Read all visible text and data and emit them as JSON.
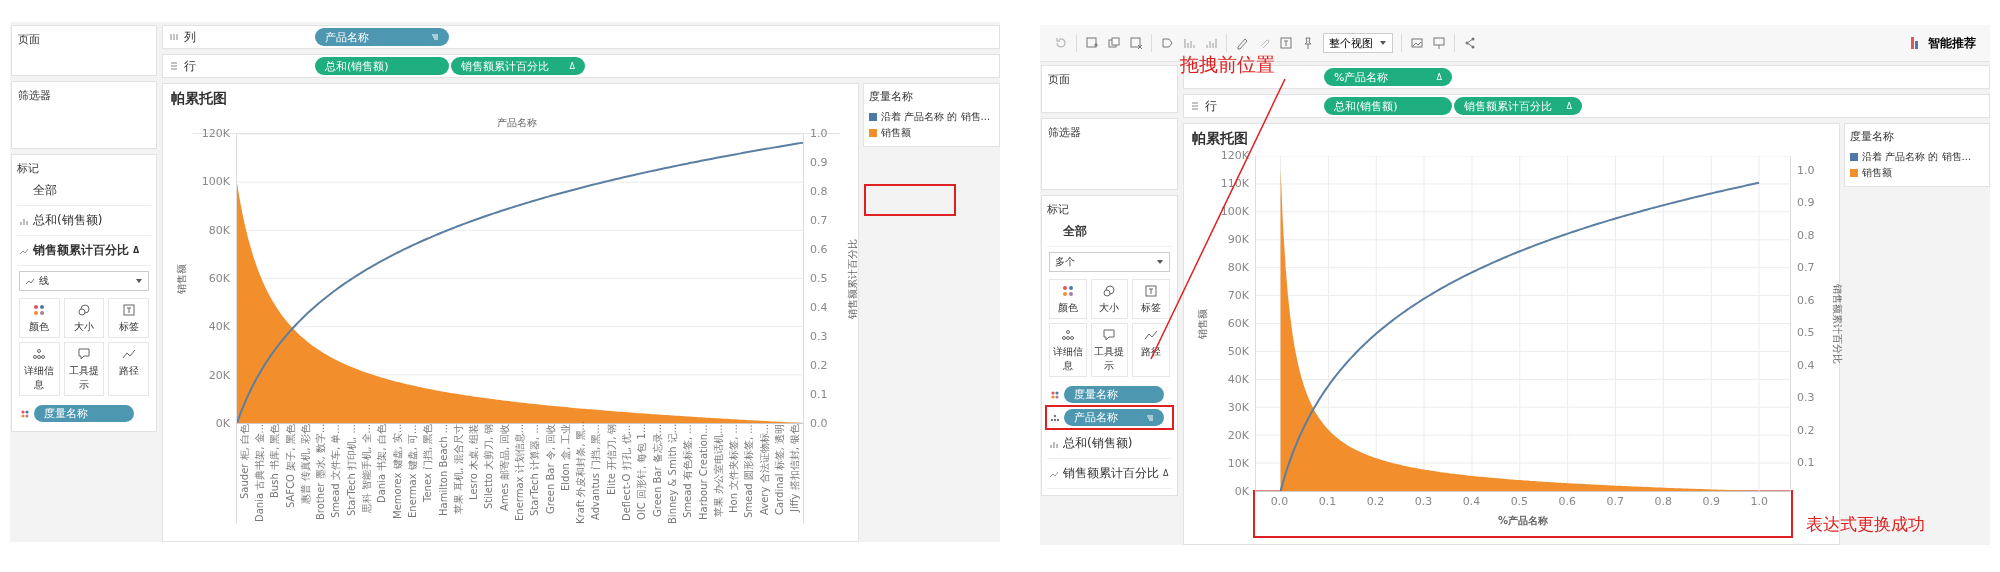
{
  "screens": [
    {
      "panes": {
        "pages": "页面",
        "filters": "筛选器"
      },
      "shelves": [
        {
          "kind": "columns",
          "label": "列",
          "pills": [
            {
              "label": "产品名称",
              "kind": "dimension",
              "sorted": true
            }
          ]
        },
        {
          "kind": "rows",
          "label": "行",
          "pills": [
            {
              "label": "总和(销售额)",
              "kind": "measure",
              "sorted": false
            },
            {
              "label": "销售额累计百分比",
              "kind": "measure",
              "sorted": false,
              "badge": "Δ"
            }
          ]
        }
      ],
      "marks": {
        "title": "标记",
        "tabs": [
          {
            "label": "全部",
            "kind": "all",
            "selected": false
          },
          {
            "label": "总和(销售额)",
            "kind": "bar",
            "selected": false
          },
          {
            "label": "销售额累计百分比",
            "kind": "line",
            "selected": true,
            "badge": "Δ"
          }
        ],
        "mark_type": {
          "kind": "line",
          "value": "线"
        },
        "buttons": [
          {
            "label": "颜色",
            "kind": "color"
          },
          {
            "label": "大小",
            "kind": "size"
          },
          {
            "label": "标签",
            "kind": "label"
          },
          {
            "label": "详细信息",
            "kind": "detail"
          },
          {
            "label": "工具提示",
            "kind": "tooltip"
          },
          {
            "label": "路径",
            "kind": "path"
          }
        ],
        "pills": [
          {
            "label": "度量名称",
            "kind": "color",
            "sorted": false,
            "annotated": false
          }
        ]
      },
      "chart": {
        "title": "帕累托图",
        "x_header": "产品名称",
        "y_label": "销售额",
        "y2_label": "销售额累计百分比",
        "y_ticks": [
          "120K",
          "100K",
          "80K",
          "60K",
          "40K",
          "20K",
          "0K"
        ],
        "y2_ticks": [
          "1.0",
          "0.9",
          "0.8",
          "0.7",
          "0.6",
          "0.5",
          "0.4",
          "0.3",
          "0.2",
          "0.1",
          "0.0"
        ],
        "x_labels": [
          "Sauder 柜, 白色",
          "Dania 古典书架, 金...",
          "Bush 书库, 黑色",
          "SAFCO 架子, 黑色",
          "惠普 传真机, 彩色",
          "Brother 墨水, 数字...",
          "Smead 文件车, 单...",
          "StarTech 打印机, ...",
          "思科 智能手机, 全...",
          "Dania 书架, 白色",
          "Memorex 键盘, 实...",
          "Enermax 键盘, 可...",
          "Tenex 门挡, 黑色",
          "Hamilton Beach ...",
          "苹果 耳机, 混合尺寸",
          "Lesro 木桌, 组装",
          "Stiletto 大剪刀, 钢",
          "Ames 邮寄品, 回收",
          "Enermax 计划信息...",
          "StarTech 计算器, ...",
          "Green Bar 令, 回收",
          "Eldon 盒, 工业",
          "Kraft 外皮和封条, 黑...",
          "Advantus 门挡, 黑...",
          "Elite 开信刀, 钢",
          "Deflect-O 打孔, 优...",
          "OIC 回形针, 每包 1...",
          "Green Bar 备忘录...",
          "Binney & Smith 记...",
          "Smead 有色标签, ...",
          "Harbour Creation...",
          "苹果 办公室电话机...",
          "Hon 文件夹标签, ...",
          "Smead 圆形标签, ...",
          "Avery 合法证物标...",
          "Cardinal 标签, 透明",
          "Jiffy 搭扣信封, 银色"
        ]
      },
      "legend": {
        "title": "度量名称",
        "annotation_box": true,
        "items": [
          {
            "label": "沿着 产品名称 的 销售...",
            "color": "#4e79a7"
          },
          {
            "label": "销售额",
            "color": "#f28e2b"
          }
        ]
      }
    },
    {
      "toolbar": {
        "view": "整个视图",
        "recommend": "智能推荐"
      },
      "panes": {
        "pages": "页面",
        "filters": "筛选器"
      },
      "shelf_note": "拖拽前位置",
      "shelves": [
        {
          "pills": [
            {
              "label": "%产品名称",
              "kind": "measure",
              "sorted": false,
              "badge": "Δ"
            }
          ]
        },
        {
          "kind": "rows",
          "label": "行",
          "pills": [
            {
              "label": "总和(销售额)",
              "kind": "measure",
              "sorted": false
            },
            {
              "label": "销售额累计百分比",
              "kind": "measure",
              "sorted": false,
              "badge": "Δ"
            }
          ]
        }
      ],
      "marks": {
        "title": "标记",
        "tabs": [
          {
            "label": "全部",
            "kind": "all",
            "selected": true
          },
          {
            "label": "总和(销售额)",
            "kind": "bar",
            "selected": false
          },
          {
            "label": "销售额累计百分比",
            "kind": "line",
            "selected": false,
            "badge": "Δ"
          }
        ],
        "mark_type": {
          "kind": "multiple",
          "value": "多个"
        },
        "buttons": [
          {
            "label": "颜色",
            "kind": "color"
          },
          {
            "label": "大小",
            "kind": "size"
          },
          {
            "label": "标签",
            "kind": "label"
          },
          {
            "label": "详细信息",
            "kind": "detail"
          },
          {
            "label": "工具提示",
            "kind": "tooltip"
          },
          {
            "label": "路径",
            "kind": "path"
          }
        ],
        "pills": [
          {
            "label": "度量名称",
            "kind": "color",
            "sorted": false,
            "annotated": false
          },
          {
            "label": "产品名称",
            "kind": "detail",
            "sorted": true,
            "annotated": true
          }
        ]
      },
      "chart": {
        "title": "帕累托图",
        "y_label": "销售额",
        "y2_label": "销售额累计百分比",
        "y_ticks": [
          "120K",
          "110K",
          "100K",
          "90K",
          "80K",
          "70K",
          "60K",
          "50K",
          "40K",
          "30K",
          "20K",
          "10K",
          "0K"
        ],
        "y2_ticks": [
          "1.0",
          "0.9",
          "0.8",
          "0.7",
          "0.6",
          "0.5",
          "0.4",
          "0.3",
          "0.2",
          "0.1"
        ],
        "x_ticks": [
          "0.0",
          "0.1",
          "0.2",
          "0.3",
          "0.4",
          "0.5",
          "0.6",
          "0.7",
          "0.8",
          "0.9",
          "1.0"
        ],
        "x_label": "%产品名称",
        "x_annotated": true,
        "axis_note": "表达式更换成功"
      },
      "legend": {
        "title": "度量名称",
        "annotation_box": false,
        "items": [
          {
            "label": "沿着 产品名称 的 销售...",
            "color": "#4e79a7"
          },
          {
            "label": "销售额",
            "color": "#f28e2b"
          }
        ]
      }
    }
  ]
}
